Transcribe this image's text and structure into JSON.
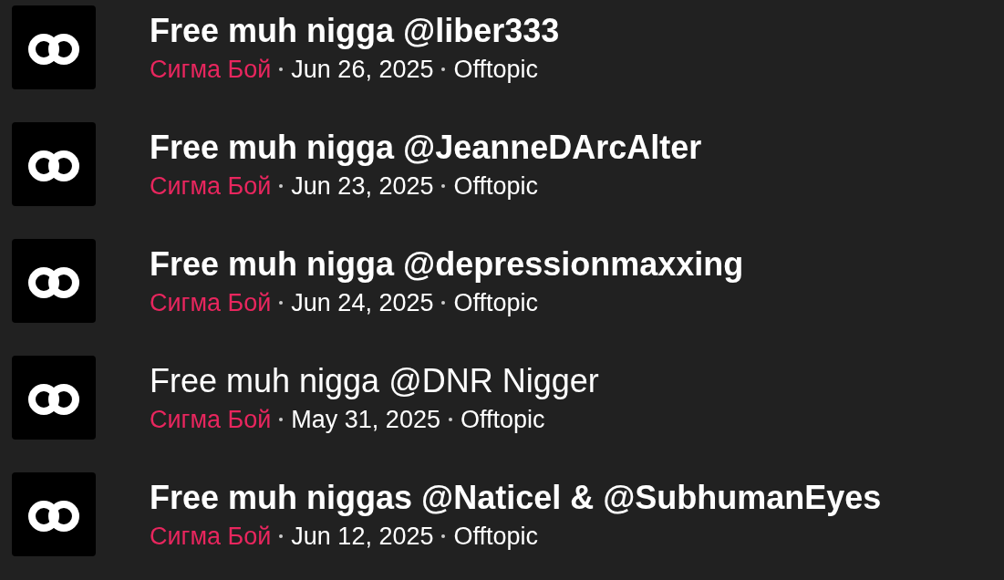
{
  "threads": [
    {
      "title": "Free muh nigga @liber333",
      "unread": true,
      "author": "Сигма Бой",
      "date": "Jun 26, 2025",
      "forum": "Offtopic"
    },
    {
      "title": "Free muh nigga @JeanneDArcAlter",
      "unread": true,
      "author": "Сигма Бой",
      "date": "Jun 23, 2025",
      "forum": "Offtopic"
    },
    {
      "title": "Free muh nigga @depressionmaxxing",
      "unread": true,
      "author": "Сигма Бой",
      "date": "Jun 24, 2025",
      "forum": "Offtopic"
    },
    {
      "title": "Free muh nigga @DNR Nigger",
      "unread": false,
      "author": "Сигма Бой",
      "date": "May 31, 2025",
      "forum": "Offtopic"
    },
    {
      "title": "Free muh niggas @Naticel & @SubhumanEyes",
      "unread": true,
      "author": "Сигма Бой",
      "date": "Jun 12, 2025",
      "forum": "Offtopic"
    }
  ]
}
